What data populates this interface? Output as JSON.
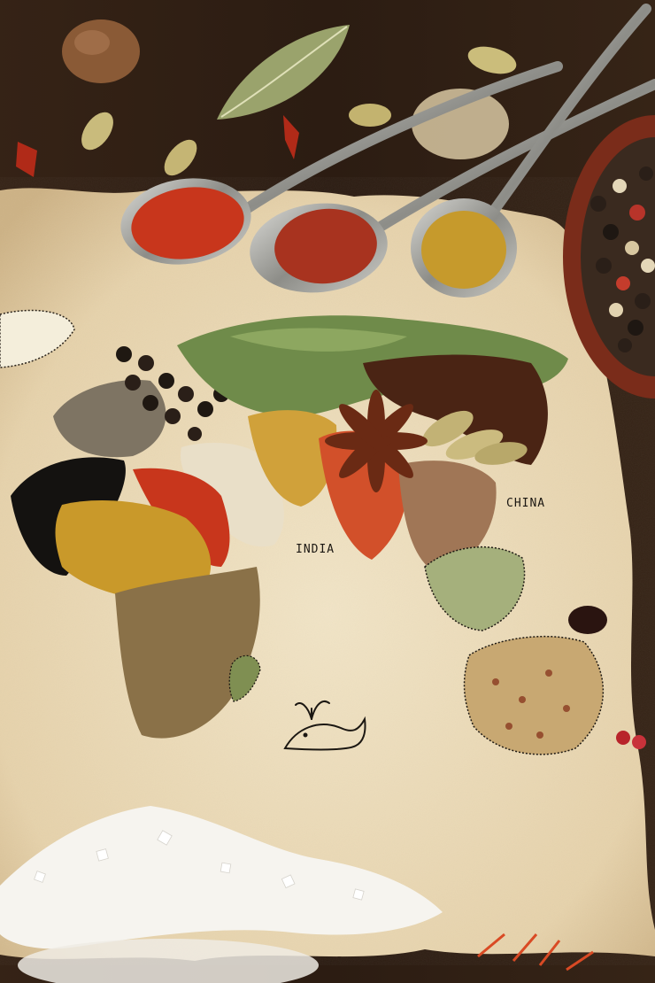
{
  "photo": {
    "labels": {
      "india": "INDIA",
      "china": "CHINA"
    },
    "colors": {
      "wood": "#2e1e14",
      "parchment": "#ecdcbc",
      "paprika": "#c8361c",
      "chili_flakes": "#a8331f",
      "curry": "#c69a2c",
      "turmeric": "#d0a13a",
      "black_sesame": "#141210",
      "mustard_seed": "#c9992a",
      "cumin": "#8a7148",
      "sesame": "#e9dfc8",
      "green_herbs": "#6f8b4a",
      "cinnamon_sticks": "#4a2414",
      "cardamom": "#c2b275",
      "peppercorn": "#2a1f18",
      "salt": "#f6f4ef",
      "star_anise": "#6a2a14",
      "bowl": "#7a2c1a",
      "spoon": "#a7a7a2"
    }
  }
}
